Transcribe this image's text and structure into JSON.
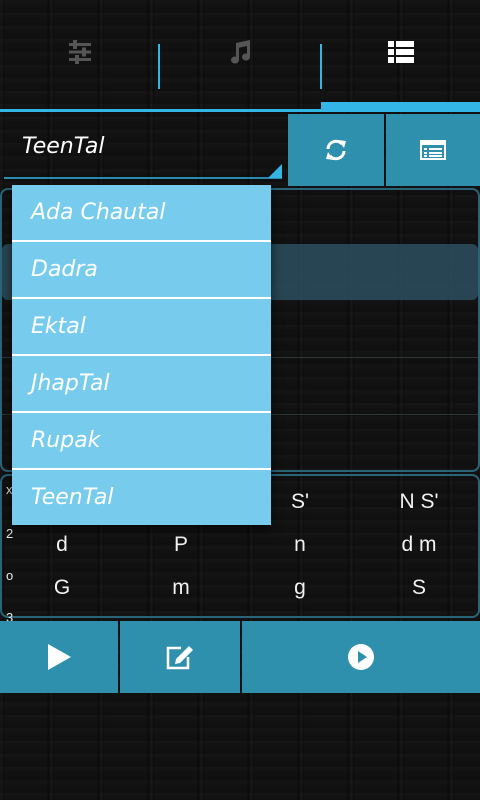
{
  "tabs": [
    {
      "icon": "sliders-icon",
      "active": false
    },
    {
      "icon": "music-note-icon",
      "active": false
    },
    {
      "icon": "list-icon",
      "active": true
    }
  ],
  "colors": {
    "accent": "#33b5e5",
    "button": "#2e90ad",
    "dropdown_item": "#77ccee"
  },
  "spinner": {
    "selected": "TeenTal"
  },
  "toolbar": {
    "refresh_icon": "refresh-icon",
    "list_icon": "list-view-icon"
  },
  "dropdown": {
    "options": [
      "Ada Chautal",
      "Dadra",
      "Ektal",
      "JhapTal",
      "Rupak",
      "TeenTal"
    ]
  },
  "grid": {
    "markers": [
      "x",
      "2",
      "o",
      "3"
    ],
    "rows": [
      [
        "",
        "",
        "S'",
        "N S'"
      ],
      [
        "d",
        "P",
        "n",
        "d m"
      ],
      [
        "G",
        "m",
        "g",
        "S"
      ]
    ]
  },
  "bottom_bar": {
    "icons": [
      "play-icon",
      "edit-icon",
      "play-circle-icon"
    ]
  }
}
